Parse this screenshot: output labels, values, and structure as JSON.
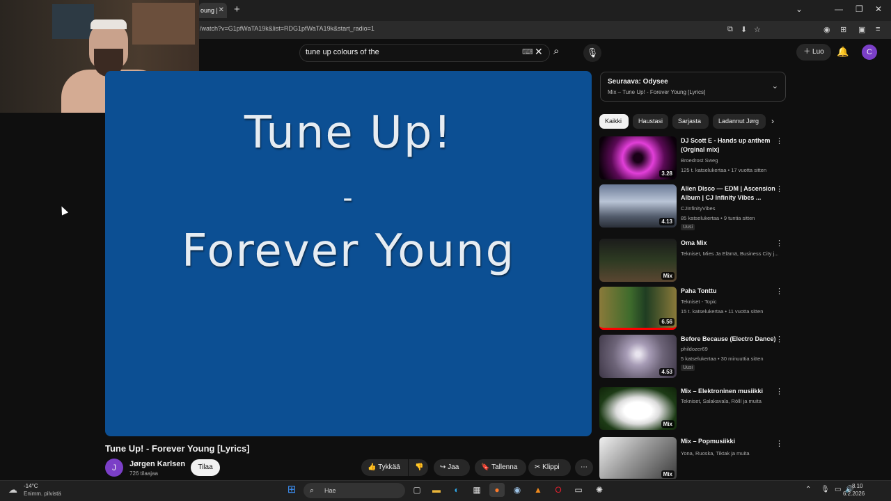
{
  "browser": {
    "tab_title": "oung |",
    "url": "/watch?v=G1pfWaTA19k&list=RDG1pfWaTA19k&start_radio=1"
  },
  "masthead": {
    "search_value": "tune up colours of the",
    "create_label": "Luo",
    "avatar_letter": "C"
  },
  "video": {
    "line1": "Tune Up!",
    "line2": "-",
    "line3": "Forever Young",
    "title": "Tune Up! - Forever Young [Lyrics]",
    "channel_initial": "J",
    "channel_name": "Jørgen Karlsen",
    "subscribers": "726 tilaajaa",
    "subscribe_label": "Tilaa",
    "actions": {
      "like": "Tykkää",
      "share": "Jaa",
      "save": "Tallenna",
      "clip": "Klippi"
    }
  },
  "sidebar": {
    "upnext_title": "Seuraava: Odysee",
    "upnext_sub": "Mix – Tune Up! - Forever Young [Lyrics]",
    "chips": [
      "Kaikki",
      "Haustasi",
      "Sarjasta",
      "Ladannut Jørg"
    ],
    "recommendations": [
      {
        "title": "DJ Scott E - Hands up anthem (Orginal mix)",
        "channel": "Broedrost Sweg",
        "stats": "125 t. katselukertaa • 17 vuotta sitten",
        "duration": "3.28",
        "badge": ""
      },
      {
        "title": "Alien Disco — EDM | Ascension Album | CJ Infinity Vibes ...",
        "channel": "CJInfinityVibes",
        "stats": "85 katselukertaa • 9 tuntia sitten",
        "duration": "4.13",
        "badge": "Uusi"
      },
      {
        "title": "Oma Mix",
        "channel": "Tekniset, Mies Ja Elämä, Business City j...",
        "stats": "",
        "duration": "Mix",
        "badge": ""
      },
      {
        "title": "Paha Tonttu",
        "channel": "Tekniset - Topic",
        "stats": "15 t. katselukertaa • 11 vuotta sitten",
        "duration": "6.56",
        "badge": ""
      },
      {
        "title": "Before Because (Electro Dance)",
        "channel": "phildozer69",
        "stats": "5 katselukertaa • 30 minuuttia sitten",
        "duration": "4.53",
        "badge": "Uusi"
      },
      {
        "title": "Mix – Elektroninen musiikki",
        "channel": "Tekniset, Salakavala, Röllí ja muita",
        "stats": "",
        "duration": "Mix",
        "badge": ""
      },
      {
        "title": "Mix – Popmusiikki",
        "channel": "Yona, Ruoska, Tiktak ja muita",
        "stats": "",
        "duration": "Mix",
        "badge": ""
      }
    ]
  },
  "taskbar": {
    "temp": "-14°C",
    "weather": "Enimm. pilvistä",
    "search_placeholder": "Hae",
    "time": "8.10",
    "date": "6.2.2026"
  },
  "colors": {
    "video_bg": "#0c4f93",
    "accent": "#7b3fc7",
    "page_bg": "#0f0f0f"
  }
}
